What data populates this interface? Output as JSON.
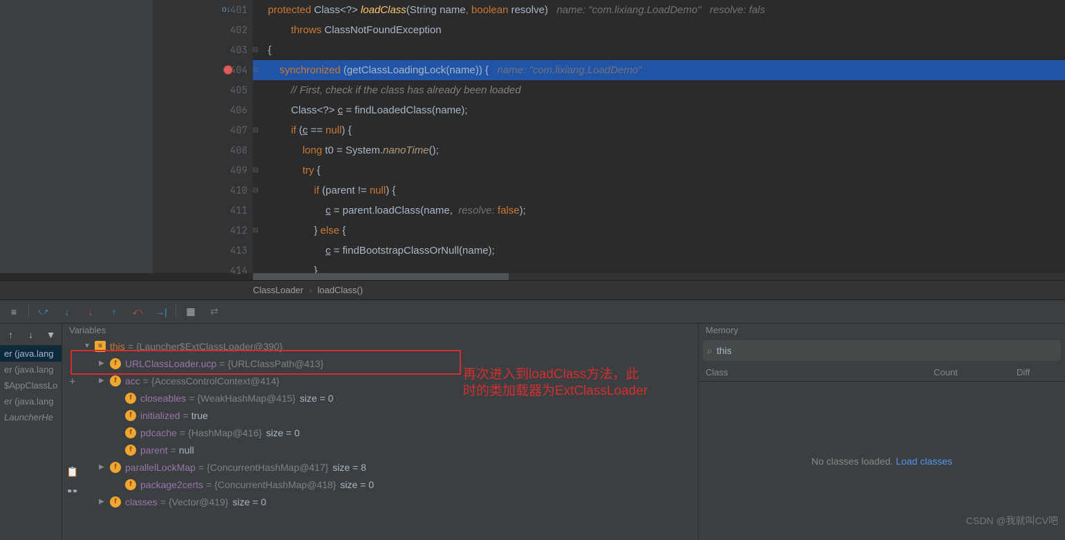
{
  "editor": {
    "lines": [
      {
        "num": "401",
        "html": "    <span class='c-kw'>protected</span> Class&lt;?&gt; <span class='c-method'>loadClass</span>(String name<span class='c-kw'>,</span> <span class='c-kw'>boolean</span> resolve)   <span class='c-param'>name: \"com.lixiang.LoadDemo\"   resolve: fals</span>",
        "icon": "override"
      },
      {
        "num": "402",
        "html": "            <span class='c-kw'>throws</span> ClassNotFoundException"
      },
      {
        "num": "403",
        "html": "    {",
        "fold": true
      },
      {
        "num": "404",
        "html": "        <span class='c-kw'>synchronized</span> (getClassLoadingLock(name)) {   <span class='c-param'>name: \"com.lixiang.LoadDemo\"</span>",
        "breakpoint": true,
        "highlight": true,
        "fold": true
      },
      {
        "num": "405",
        "html": "            <span class='c-comment'>// First, check if the class has already been loaded</span>"
      },
      {
        "num": "406",
        "html": "            Class&lt;?&gt; <span class='c-var'>c</span> = findLoadedClass(name);"
      },
      {
        "num": "407",
        "html": "            <span class='c-kw'>if</span> (<span class='c-var'>c</span> == <span class='c-kw'>null</span>) {",
        "fold": true
      },
      {
        "num": "408",
        "html": "                <span class='c-kw'>long</span> t0 = System.<span class='c-method2'>nanoTime</span>();"
      },
      {
        "num": "409",
        "html": "                <span class='c-kw'>try</span> {",
        "fold": true
      },
      {
        "num": "410",
        "html": "                    <span class='c-kw'>if</span> (parent != <span class='c-kw'>null</span>) {",
        "fold": true
      },
      {
        "num": "411",
        "html": "                        <span class='c-var'>c</span> = parent.loadClass(name,  <span class='c-param'>resolve:</span> <span class='c-kw'>false</span>);"
      },
      {
        "num": "412",
        "html": "                    } <span class='c-kw'>else</span> {",
        "fold": true
      },
      {
        "num": "413",
        "html": "                        <span class='c-var'>c</span> = findBootstrapClassOrNull(name);"
      },
      {
        "num": "414",
        "html": "                    }"
      }
    ],
    "breadcrumb": [
      "ClassLoader",
      "loadClass()"
    ]
  },
  "variables": {
    "title": "Variables",
    "items": [
      {
        "depth": 0,
        "expand": "▼",
        "icon": "this",
        "nameClass": "kw",
        "name": "this",
        "val": "{Launcher$ExtClassLoader@390}"
      },
      {
        "depth": 1,
        "expand": "▶",
        "icon": "f",
        "name": "URLClassLoader.ucp",
        "val": "{URLClassPath@413}"
      },
      {
        "depth": 1,
        "expand": "▶",
        "icon": "f",
        "name": "acc",
        "val": "{AccessControlContext@414}"
      },
      {
        "depth": 2,
        "expand": "",
        "icon": "f",
        "name": "closeables",
        "val": "{WeakHashMap@415}",
        "extra": "size = 0"
      },
      {
        "depth": 2,
        "expand": "",
        "icon": "f",
        "name": "initialized",
        "val": "true",
        "valLiteral": true
      },
      {
        "depth": 2,
        "expand": "",
        "icon": "f",
        "name": "pdcache",
        "val": "{HashMap@416}",
        "extra": "size = 0"
      },
      {
        "depth": 2,
        "expand": "",
        "icon": "f",
        "name": "parent",
        "val": "null",
        "valLiteral": true
      },
      {
        "depth": 1,
        "expand": "▶",
        "icon": "f",
        "name": "parallelLockMap",
        "val": "{ConcurrentHashMap@417}",
        "extra": "size = 8"
      },
      {
        "depth": 2,
        "expand": "",
        "icon": "f",
        "name": "package2certs",
        "val": "{ConcurrentHashMap@418}",
        "extra": "size = 0"
      },
      {
        "depth": 1,
        "expand": "▶",
        "icon": "f",
        "name": "classes",
        "val": "{Vector@419}",
        "extra": "size = 0"
      }
    ]
  },
  "frames": [
    {
      "text": "er (java.lang",
      "active": true
    },
    {
      "text": "er (java.lang"
    },
    {
      "text": "$AppClassLo"
    },
    {
      "text": "er (java.lang"
    },
    {
      "text": "LauncherHe",
      "italic": true
    }
  ],
  "memory": {
    "title": "Memory",
    "search_value": "this",
    "cols": [
      "Class",
      "Count",
      "Diff"
    ],
    "empty_text": "No classes loaded.",
    "empty_link": "Load classes"
  },
  "annotation": {
    "line1": "再次进入到loadClass方法，此",
    "line2": "时的类加载器为ExtClassLoader"
  },
  "watermark": "CSDN @我就叫CV吧"
}
